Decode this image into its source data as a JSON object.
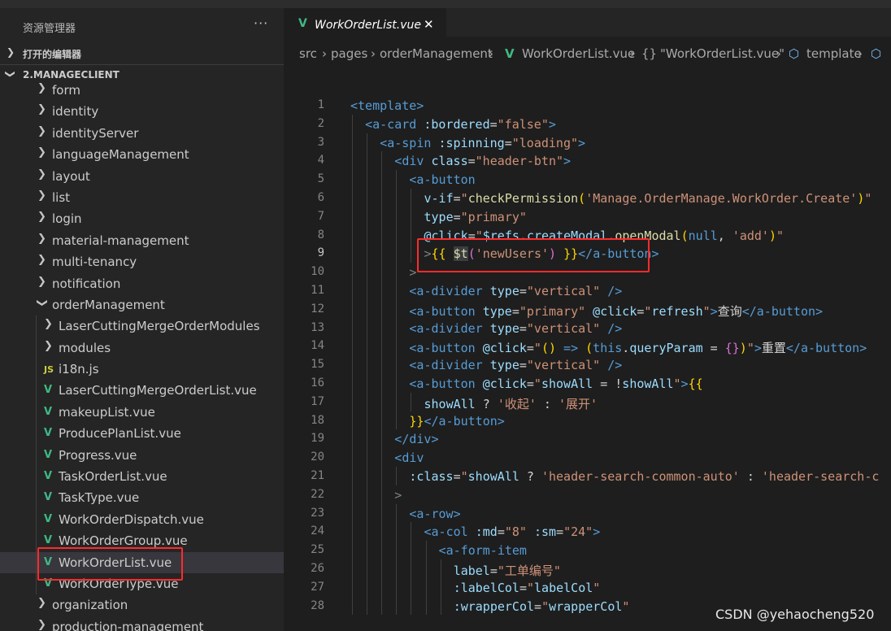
{
  "sidebar": {
    "title": "资源管理器",
    "more": "···",
    "open_editors": "打开的编辑器",
    "project": "2.MANAGECLIENT",
    "tree": [
      {
        "label": "form",
        "type": "folder",
        "depth": 1,
        "expanded": false
      },
      {
        "label": "identity",
        "type": "folder",
        "depth": 1,
        "expanded": false
      },
      {
        "label": "identityServer",
        "type": "folder",
        "depth": 1,
        "expanded": false
      },
      {
        "label": "languageManagement",
        "type": "folder",
        "depth": 1,
        "expanded": false
      },
      {
        "label": "layout",
        "type": "folder",
        "depth": 1,
        "expanded": false
      },
      {
        "label": "list",
        "type": "folder",
        "depth": 1,
        "expanded": false
      },
      {
        "label": "login",
        "type": "folder",
        "depth": 1,
        "expanded": false
      },
      {
        "label": "material-management",
        "type": "folder",
        "depth": 1,
        "expanded": false
      },
      {
        "label": "multi-tenancy",
        "type": "folder",
        "depth": 1,
        "expanded": false
      },
      {
        "label": "notification",
        "type": "folder",
        "depth": 1,
        "expanded": false
      },
      {
        "label": "orderManagement",
        "type": "folder",
        "depth": 1,
        "expanded": true
      },
      {
        "label": "LaserCuttingMergeOrderModules",
        "type": "folder",
        "depth": 2,
        "expanded": false
      },
      {
        "label": "modules",
        "type": "folder",
        "depth": 2,
        "expanded": false
      },
      {
        "label": "i18n.js",
        "type": "js",
        "depth": 2
      },
      {
        "label": "LaserCuttingMergeOrderList.vue",
        "type": "vue",
        "depth": 2
      },
      {
        "label": "makeupList.vue",
        "type": "vue",
        "depth": 2
      },
      {
        "label": "ProducePlanList.vue",
        "type": "vue",
        "depth": 2
      },
      {
        "label": "Progress.vue",
        "type": "vue",
        "depth": 2
      },
      {
        "label": "TaskOrderList.vue",
        "type": "vue",
        "depth": 2
      },
      {
        "label": "TaskType.vue",
        "type": "vue",
        "depth": 2
      },
      {
        "label": "WorkOrderDispatch.vue",
        "type": "vue",
        "depth": 2
      },
      {
        "label": "WorkOrderGroup.vue",
        "type": "vue",
        "depth": 2
      },
      {
        "label": "WorkOrderList.vue",
        "type": "vue",
        "depth": 2,
        "selected": true
      },
      {
        "label": "WorkOrderType.vue",
        "type": "vue",
        "depth": 2
      },
      {
        "label": "organization",
        "type": "folder",
        "depth": 1,
        "expanded": false
      },
      {
        "label": "production-management",
        "type": "folder",
        "depth": 1,
        "expanded": false
      }
    ]
  },
  "editor": {
    "tab": {
      "name": "WorkOrderList.vue",
      "close": "✕"
    },
    "breadcrumb": {
      "src": "src",
      "pages": "pages",
      "folder": "orderManagement",
      "file": "WorkOrderList.vue",
      "braces": "{}",
      "component": "\"WorkOrderList.vue\"",
      "template": "template"
    },
    "active_line": 9,
    "lines": [
      {
        "n": 1,
        "indent": 0,
        "tokens": [
          [
            "t-tag",
            "<template"
          ],
          [
            "t-tag",
            ">"
          ]
        ]
      },
      {
        "n": 2,
        "indent": 1,
        "tokens": [
          [
            "t-tag",
            "<a-card"
          ],
          [
            "t-txt",
            " "
          ],
          [
            "t-attr",
            ":bordered"
          ],
          [
            "t-op",
            "="
          ],
          [
            "t-str",
            "\"false\""
          ],
          [
            "t-tag",
            ">"
          ]
        ]
      },
      {
        "n": 3,
        "indent": 2,
        "tokens": [
          [
            "t-tag",
            "<a-spin"
          ],
          [
            "t-txt",
            " "
          ],
          [
            "t-attr",
            ":spinning"
          ],
          [
            "t-op",
            "="
          ],
          [
            "t-str",
            "\"loading\""
          ],
          [
            "t-tag",
            ">"
          ]
        ]
      },
      {
        "n": 4,
        "indent": 3,
        "tokens": [
          [
            "t-tag",
            "<div"
          ],
          [
            "t-txt",
            " "
          ],
          [
            "t-attr",
            "class"
          ],
          [
            "t-op",
            "="
          ],
          [
            "t-str",
            "\"header-btn\""
          ],
          [
            "t-tag",
            ">"
          ]
        ]
      },
      {
        "n": 5,
        "indent": 4,
        "tokens": [
          [
            "t-tag",
            "<a-button"
          ]
        ]
      },
      {
        "n": 6,
        "indent": 5,
        "tokens": [
          [
            "t-attr",
            "v-if"
          ],
          [
            "t-op",
            "="
          ],
          [
            "t-str",
            "\""
          ],
          [
            "t-fn",
            "checkPermission"
          ],
          [
            "t-br",
            "("
          ],
          [
            "t-str",
            "'Manage.OrderManage.WorkOrder.Create'"
          ],
          [
            "t-br",
            ")"
          ],
          [
            "t-str",
            "\""
          ]
        ]
      },
      {
        "n": 7,
        "indent": 5,
        "tokens": [
          [
            "t-attr",
            "type"
          ],
          [
            "t-op",
            "="
          ],
          [
            "t-str",
            "\"primary\""
          ]
        ]
      },
      {
        "n": 8,
        "indent": 5,
        "tokens": [
          [
            "t-attr",
            "@click"
          ],
          [
            "t-op",
            "="
          ],
          [
            "t-str",
            "\""
          ],
          [
            "t-var",
            "$refs"
          ],
          [
            "t-op",
            "."
          ],
          [
            "t-var",
            "createModal"
          ],
          [
            "t-op",
            "."
          ],
          [
            "t-fn",
            "openModal"
          ],
          [
            "t-br",
            "("
          ],
          [
            "t-kw",
            "null"
          ],
          [
            "t-op",
            ", "
          ],
          [
            "t-str",
            "'add'"
          ],
          [
            "t-br",
            ")"
          ],
          [
            "t-str",
            "\""
          ]
        ]
      },
      {
        "n": 9,
        "indent": 5,
        "tokens": [
          [
            "t-punc",
            ">"
          ],
          [
            "t-br",
            "{{"
          ],
          [
            "t-txt",
            " "
          ],
          [
            "t-fn hlword",
            "$t"
          ],
          [
            "t-br2",
            "("
          ],
          [
            "t-str",
            "'newUsers'"
          ],
          [
            "t-br2",
            ")"
          ],
          [
            "t-txt",
            " "
          ],
          [
            "t-br",
            "}}"
          ],
          [
            "t-tag",
            "</a-button"
          ],
          [
            "t-tag",
            ">"
          ]
        ],
        "cursor_col": 1
      },
      {
        "n": 10,
        "indent": 4,
        "tokens": [
          [
            "t-punc",
            ">"
          ]
        ]
      },
      {
        "n": 11,
        "indent": 4,
        "tokens": [
          [
            "t-tag",
            "<a-divider"
          ],
          [
            "t-txt",
            " "
          ],
          [
            "t-attr",
            "type"
          ],
          [
            "t-op",
            "="
          ],
          [
            "t-str",
            "\"vertical\""
          ],
          [
            "t-txt",
            " "
          ],
          [
            "t-tag",
            "/>"
          ]
        ]
      },
      {
        "n": 12,
        "indent": 4,
        "tokens": [
          [
            "t-tag",
            "<a-button"
          ],
          [
            "t-txt",
            " "
          ],
          [
            "t-attr",
            "type"
          ],
          [
            "t-op",
            "="
          ],
          [
            "t-str",
            "\"primary\""
          ],
          [
            "t-txt",
            " "
          ],
          [
            "t-attr",
            "@click"
          ],
          [
            "t-op",
            "="
          ],
          [
            "t-str",
            "\""
          ],
          [
            "t-var",
            "refresh"
          ],
          [
            "t-str",
            "\""
          ],
          [
            "t-tag",
            ">"
          ],
          [
            "t-txt",
            "查询"
          ],
          [
            "t-tag",
            "</a-button"
          ],
          [
            "t-tag",
            ">"
          ]
        ]
      },
      {
        "n": 13,
        "indent": 4,
        "tokens": [
          [
            "t-tag",
            "<a-divider"
          ],
          [
            "t-txt",
            " "
          ],
          [
            "t-attr",
            "type"
          ],
          [
            "t-op",
            "="
          ],
          [
            "t-str",
            "\"vertical\""
          ],
          [
            "t-txt",
            " "
          ],
          [
            "t-tag",
            "/>"
          ]
        ]
      },
      {
        "n": 14,
        "indent": 4,
        "tokens": [
          [
            "t-tag",
            "<a-button"
          ],
          [
            "t-txt",
            " "
          ],
          [
            "t-attr",
            "@click"
          ],
          [
            "t-op",
            "="
          ],
          [
            "t-str",
            "\""
          ],
          [
            "t-br",
            "()"
          ],
          [
            "t-txt",
            " "
          ],
          [
            "t-kw",
            "=>"
          ],
          [
            "t-txt",
            " "
          ],
          [
            "t-br",
            "("
          ],
          [
            "t-kw",
            "this"
          ],
          [
            "t-op",
            "."
          ],
          [
            "t-var",
            "queryParam"
          ],
          [
            "t-txt",
            " "
          ],
          [
            "t-op",
            "="
          ],
          [
            "t-txt",
            " "
          ],
          [
            "t-br2",
            "{}"
          ],
          [
            "t-br",
            ")"
          ],
          [
            "t-str",
            "\""
          ],
          [
            "t-tag",
            ">"
          ],
          [
            "t-txt",
            "重置"
          ],
          [
            "t-tag",
            "</a-button"
          ],
          [
            "t-tag",
            ">"
          ]
        ]
      },
      {
        "n": 15,
        "indent": 4,
        "tokens": [
          [
            "t-tag",
            "<a-divider"
          ],
          [
            "t-txt",
            " "
          ],
          [
            "t-attr",
            "type"
          ],
          [
            "t-op",
            "="
          ],
          [
            "t-str",
            "\"vertical\""
          ],
          [
            "t-txt",
            " "
          ],
          [
            "t-tag",
            "/>"
          ]
        ]
      },
      {
        "n": 16,
        "indent": 4,
        "tokens": [
          [
            "t-tag",
            "<a-button"
          ],
          [
            "t-txt",
            " "
          ],
          [
            "t-attr",
            "@click"
          ],
          [
            "t-op",
            "="
          ],
          [
            "t-str",
            "\""
          ],
          [
            "t-var",
            "showAll"
          ],
          [
            "t-txt",
            " "
          ],
          [
            "t-op",
            "="
          ],
          [
            "t-txt",
            " "
          ],
          [
            "t-op",
            "!"
          ],
          [
            "t-var",
            "showAll"
          ],
          [
            "t-str",
            "\""
          ],
          [
            "t-tag",
            ">"
          ],
          [
            "t-br",
            "{{"
          ]
        ]
      },
      {
        "n": 17,
        "indent": 5,
        "tokens": [
          [
            "t-var",
            "showAll"
          ],
          [
            "t-txt",
            " "
          ],
          [
            "t-op",
            "?"
          ],
          [
            "t-txt",
            " "
          ],
          [
            "t-str",
            "'收起'"
          ],
          [
            "t-txt",
            " "
          ],
          [
            "t-op",
            ":"
          ],
          [
            "t-txt",
            " "
          ],
          [
            "t-str",
            "'展开'"
          ]
        ]
      },
      {
        "n": 18,
        "indent": 4,
        "tokens": [
          [
            "t-br",
            "}}"
          ],
          [
            "t-tag",
            "</a-button"
          ],
          [
            "t-tag",
            ">"
          ]
        ]
      },
      {
        "n": 19,
        "indent": 3,
        "tokens": [
          [
            "t-tag",
            "</div"
          ],
          [
            "t-tag",
            ">"
          ]
        ]
      },
      {
        "n": 20,
        "indent": 3,
        "tokens": [
          [
            "t-tag",
            "<div"
          ]
        ]
      },
      {
        "n": 21,
        "indent": 4,
        "tokens": [
          [
            "t-attr",
            ":class"
          ],
          [
            "t-op",
            "="
          ],
          [
            "t-str",
            "\""
          ],
          [
            "t-var",
            "showAll"
          ],
          [
            "t-txt",
            " "
          ],
          [
            "t-op",
            "?"
          ],
          [
            "t-txt",
            " "
          ],
          [
            "t-str",
            "'header-search-common-auto'"
          ],
          [
            "t-txt",
            " "
          ],
          [
            "t-op",
            ":"
          ],
          [
            "t-txt",
            " "
          ],
          [
            "t-str",
            "'header-search-c"
          ]
        ]
      },
      {
        "n": 22,
        "indent": 3,
        "tokens": [
          [
            "t-punc",
            ">"
          ]
        ]
      },
      {
        "n": 23,
        "indent": 4,
        "tokens": [
          [
            "t-tag",
            "<a-row"
          ],
          [
            "t-tag",
            ">"
          ]
        ]
      },
      {
        "n": 24,
        "indent": 5,
        "tokens": [
          [
            "t-tag",
            "<a-col"
          ],
          [
            "t-txt",
            " "
          ],
          [
            "t-attr",
            ":md"
          ],
          [
            "t-op",
            "="
          ],
          [
            "t-str",
            "\"8\""
          ],
          [
            "t-txt",
            " "
          ],
          [
            "t-attr",
            ":sm"
          ],
          [
            "t-op",
            "="
          ],
          [
            "t-str",
            "\"24\""
          ],
          [
            "t-tag",
            ">"
          ]
        ]
      },
      {
        "n": 25,
        "indent": 6,
        "tokens": [
          [
            "t-tag",
            "<a-form-item"
          ]
        ]
      },
      {
        "n": 26,
        "indent": 7,
        "tokens": [
          [
            "t-attr",
            "label"
          ],
          [
            "t-op",
            "="
          ],
          [
            "t-str",
            "\"工单编号\""
          ]
        ]
      },
      {
        "n": 27,
        "indent": 7,
        "tokens": [
          [
            "t-attr",
            ":labelCol"
          ],
          [
            "t-op",
            "="
          ],
          [
            "t-str",
            "\""
          ],
          [
            "t-var",
            "labelCol"
          ],
          [
            "t-str",
            "\""
          ]
        ]
      },
      {
        "n": 28,
        "indent": 7,
        "tokens": [
          [
            "t-attr",
            ":wrapperCol"
          ],
          [
            "t-op",
            "="
          ],
          [
            "t-str",
            "\""
          ],
          [
            "t-var",
            "wrapperCol"
          ],
          [
            "t-str",
            "\""
          ]
        ]
      }
    ]
  },
  "watermark": "CSDN @yehaocheng520",
  "colors": {
    "accent_red": "#ff2b2b",
    "vue_green": "#41b883",
    "bg": "#1e1e1e",
    "sidebar_bg": "#252526"
  }
}
